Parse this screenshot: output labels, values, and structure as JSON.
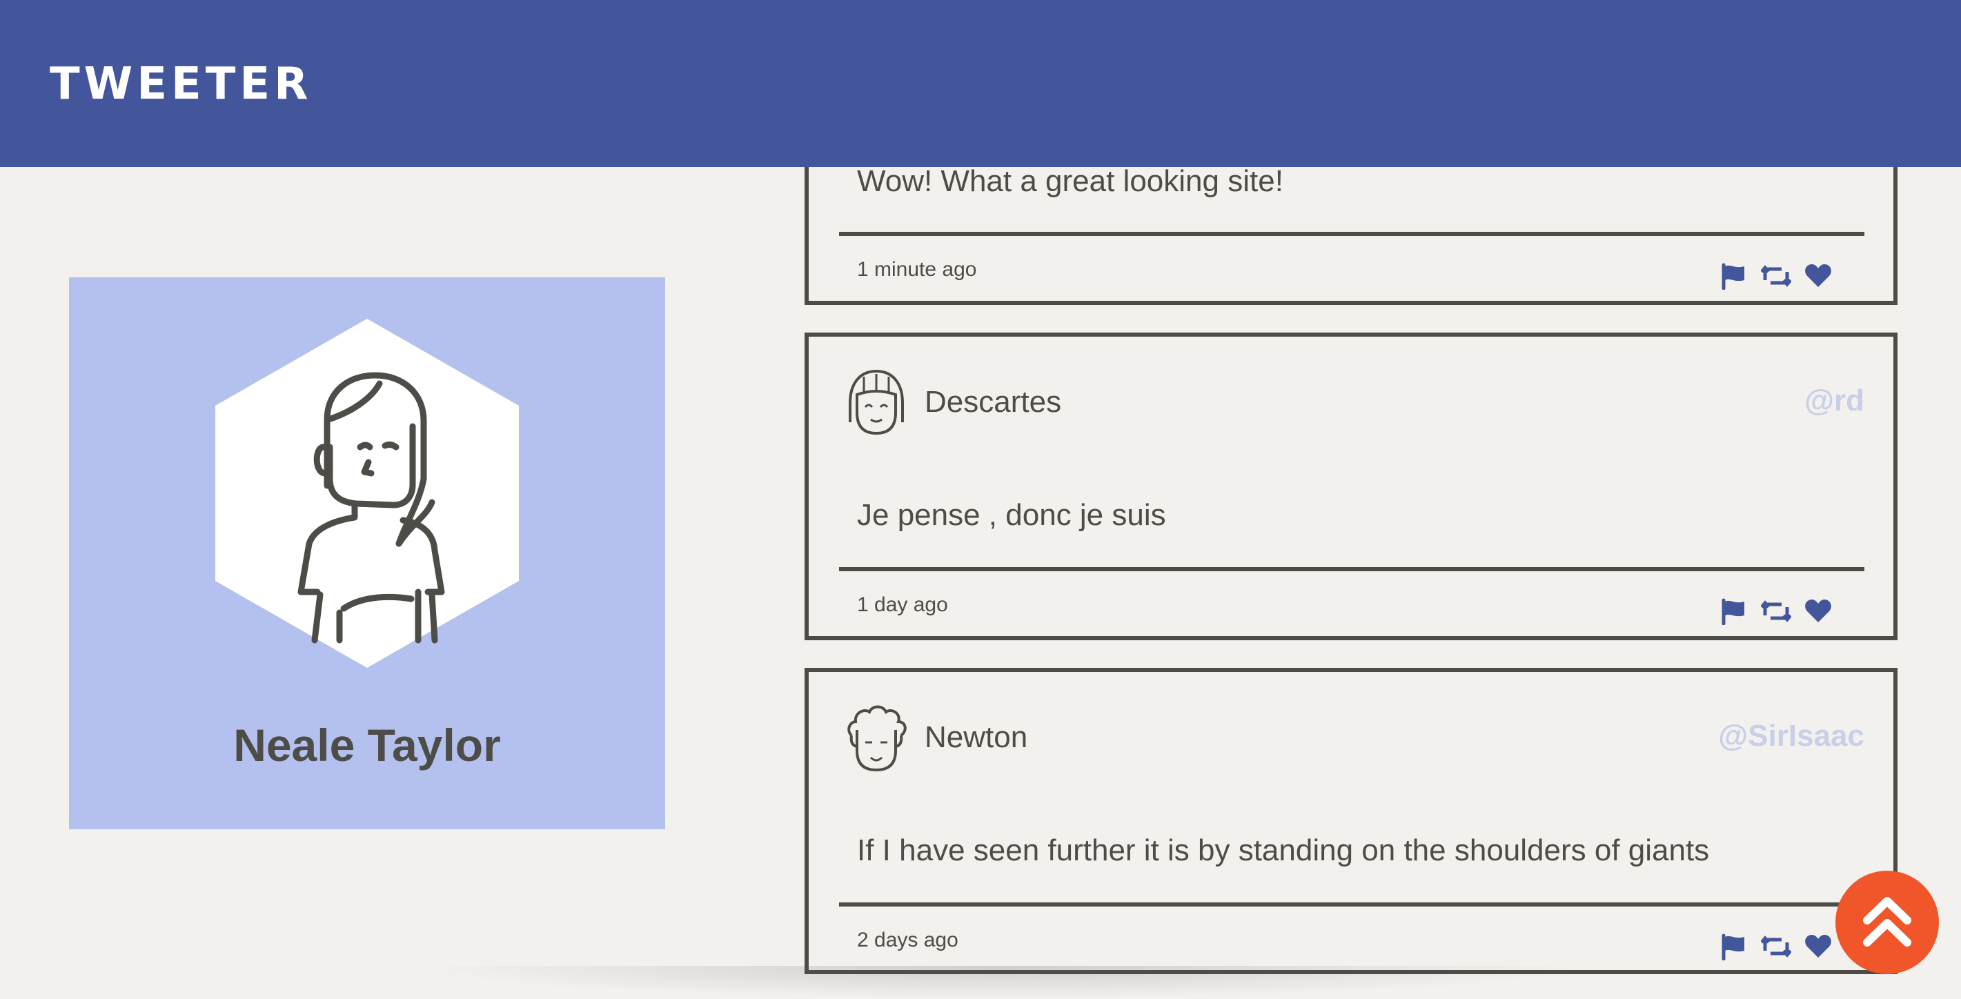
{
  "app": {
    "brand": "TWEETER"
  },
  "colors": {
    "navbar": "#43559b",
    "profile_card": "#b4c0ee",
    "page_background": "#f3f1ee",
    "text": "#4d4c47",
    "handle": "#c9cfe8",
    "action_icons": "#43559b",
    "scroll_button": "#f0562a"
  },
  "profile": {
    "name": "Neale Taylor",
    "avatar_icon": "woman-avatar-icon"
  },
  "tweets": [
    {
      "name": "",
      "handle": "",
      "content": "Wow! What a great looking site!",
      "time": "1 minute ago"
    },
    {
      "name": "Descartes",
      "handle": "@rd",
      "content": "Je pense , donc je suis",
      "time": "1 day ago",
      "avatar_icon": "girl-avatar-icon"
    },
    {
      "name": "Newton",
      "handle": "@SirIsaac",
      "content": "If I have seen further it is by standing on the shoulders of giants",
      "time": "2 days ago",
      "avatar_icon": "curly-hair-avatar-icon"
    }
  ],
  "actions": {
    "flag_icon": "flag-icon",
    "retweet_icon": "retweet-icon",
    "like_icon": "heart-icon"
  },
  "scroll_top_icon": "double-chevron-up-icon"
}
